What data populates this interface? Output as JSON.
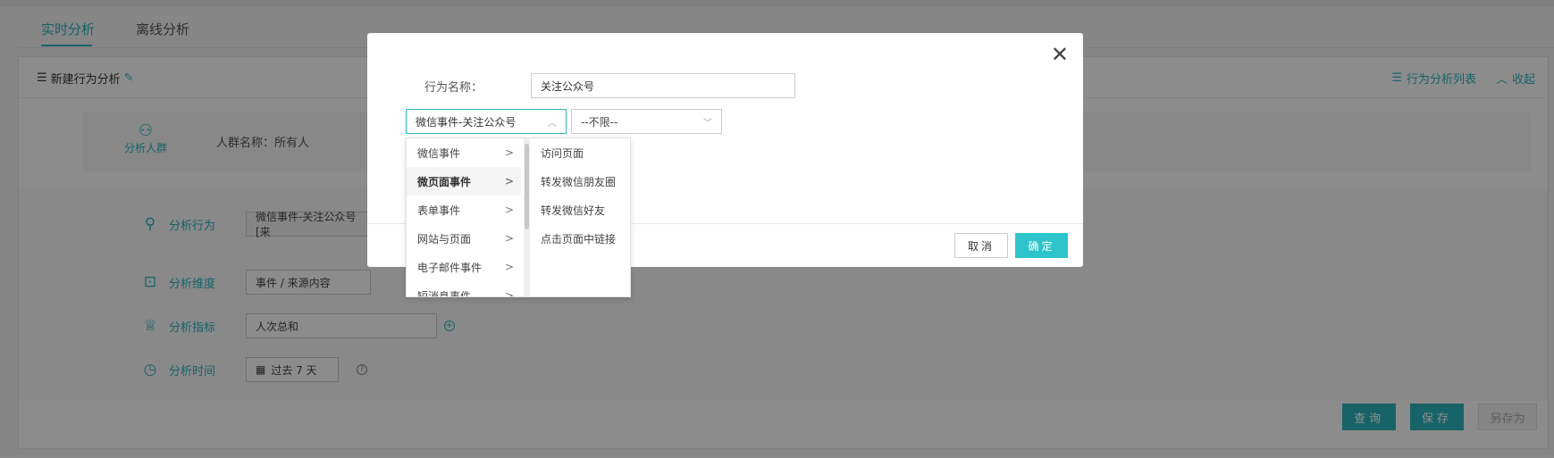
{
  "tabs": {
    "realtime": "实时分析",
    "offline": "离线分析"
  },
  "panel": {
    "new_analysis": "新建行为分析",
    "analysis_list": "行为分析列表",
    "collapse": "收起"
  },
  "crowd": {
    "label": "分析人群",
    "name_text": "人群名称：所有人"
  },
  "rows": {
    "behavior": {
      "label": "分析行为",
      "value": "微信事件-关注公众号[来"
    },
    "dimension": {
      "label": "分析维度",
      "value": "事件 / 来源内容"
    },
    "metric": {
      "label": "分析指标",
      "value": "人次总和"
    },
    "time": {
      "label": "分析时间",
      "value": "过去 7 天"
    }
  },
  "footer": {
    "query": "查询",
    "save": "保存",
    "save_as": "另存为"
  },
  "modal": {
    "name_label": "行为名称：",
    "name_value": "关注公众号",
    "cascader_value": "微信事件-关注公众号",
    "nolimit_value": "--不限--",
    "cancel": "取消",
    "confirm": "确定"
  },
  "dropdown": {
    "categories": [
      "微信事件",
      "微页面事件",
      "表单事件",
      "网站与页面",
      "电子邮件事件",
      "短消息事件"
    ],
    "hovered_index": 1,
    "sub_items": [
      "访问页面",
      "转发微信朋友圈",
      "转发微信好友",
      "点击页面中链接"
    ]
  },
  "colors": {
    "accent": "#2bb5bd",
    "confirm": "#2ec4cc"
  }
}
